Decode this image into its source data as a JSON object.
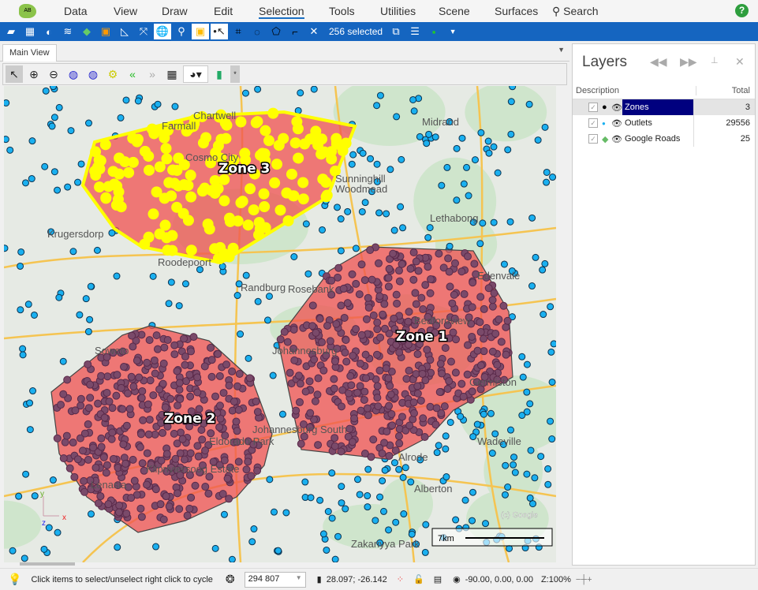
{
  "menu": {
    "items": [
      "Data",
      "View",
      "Draw",
      "Edit",
      "Selection",
      "Tools",
      "Utilities",
      "Scene",
      "Surfaces"
    ],
    "active": "Selection",
    "search": "Search",
    "logo": "AB"
  },
  "toolbar": {
    "selected_count": "256 selected"
  },
  "tabs": {
    "main": "Main View"
  },
  "map": {
    "zones": [
      "Zone 1",
      "Zone 2",
      "Zone 3"
    ],
    "places": [
      "Midrand",
      "Krugersdorp",
      "Roodepoort",
      "Sunninghill",
      "Woodmead",
      "Lethabong",
      "Johannesburg",
      "Johannesburg South",
      "Germiston",
      "Alberton",
      "Klipriviersoog Estate",
      "Zakariyya Park",
      "Cosmo City",
      "Farmall",
      "Chartwell",
      "Randburg",
      "Rosebank",
      "Bedfordview",
      "Edenvale",
      "Wadeville",
      "Lenasia",
      "Eldorado Park",
      "Soweto",
      "Alrode"
    ],
    "scale_label": "7km",
    "attribution": "(c) Google",
    "axes": {
      "x": "x",
      "y": "y",
      "z": "z"
    },
    "colors": {
      "zone_fill": "#f05050",
      "zone_selected_outline": "#ffff00",
      "outlet": "#1ab0f0",
      "outlet_in_zone": "#7a4a6a",
      "selected_outlet": "#ffff00"
    }
  },
  "layers": {
    "title": "Layers",
    "columns": [
      "Description",
      "Total"
    ],
    "rows": [
      {
        "name": "Zones",
        "total": "3",
        "selected": true
      },
      {
        "name": "Outlets",
        "total": "29556"
      },
      {
        "name": "Google Roads",
        "total": "25"
      }
    ]
  },
  "status": {
    "hint": "Click items to select/unselect right click to cycle",
    "scale": "294 807",
    "coords": "28.097; -26.142",
    "rotation": "-90.00, 0.00, 0.00",
    "zoom": "Z:100%"
  }
}
